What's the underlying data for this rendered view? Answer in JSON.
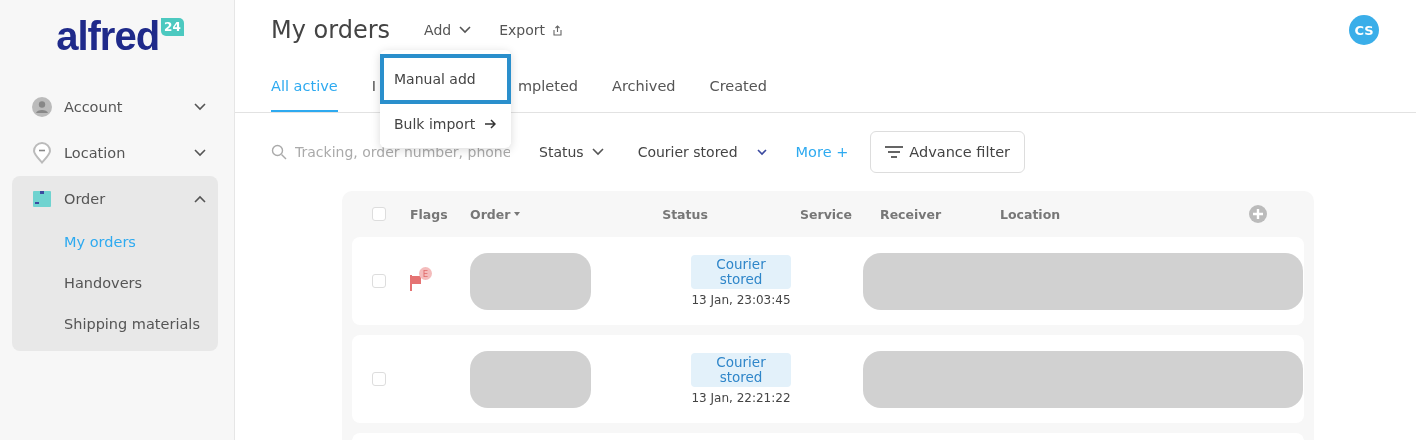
{
  "logo": {
    "name": "alfred",
    "badge": "24"
  },
  "sidebar": {
    "items": [
      {
        "label": "Account",
        "expanded": false
      },
      {
        "label": "Location",
        "expanded": false
      },
      {
        "label": "Order",
        "expanded": true,
        "children": [
          {
            "label": "My orders",
            "selected": true
          },
          {
            "label": "Handovers",
            "selected": false
          },
          {
            "label": "Shipping materials",
            "selected": false
          }
        ]
      }
    ]
  },
  "header": {
    "title": "My orders",
    "actions": [
      {
        "label": "Add"
      },
      {
        "label": "Export"
      }
    ],
    "avatar": "CS"
  },
  "add_menu": {
    "items": [
      {
        "label": "Manual add",
        "selected": true,
        "arrow": false
      },
      {
        "label": "Bulk import",
        "selected": false,
        "arrow": true
      }
    ]
  },
  "tabs": [
    {
      "label": "All active",
      "selected": true
    },
    {
      "label": "I",
      "selected": false
    },
    {
      "label": "mpleted",
      "selected": false
    },
    {
      "label": "Archived",
      "selected": false
    },
    {
      "label": "Created",
      "selected": false
    }
  ],
  "filters": {
    "search": {
      "placeholder": "Tracking, order number, phone"
    },
    "status": "Status",
    "courier": "Courier stored",
    "more": "More +",
    "advance": "Advance filter"
  },
  "table": {
    "select_all_checked": false,
    "columns": [
      "Flags",
      "Order",
      "Status",
      "Service",
      "Receiver",
      "Location"
    ],
    "rows": [
      {
        "checked": false,
        "flag": "E",
        "status": "Courier stored",
        "time": "13 Jan, 23:03:45"
      },
      {
        "checked": false,
        "flag": null,
        "status": "Courier stored",
        "time": "13 Jan, 22:21:22"
      }
    ]
  }
}
